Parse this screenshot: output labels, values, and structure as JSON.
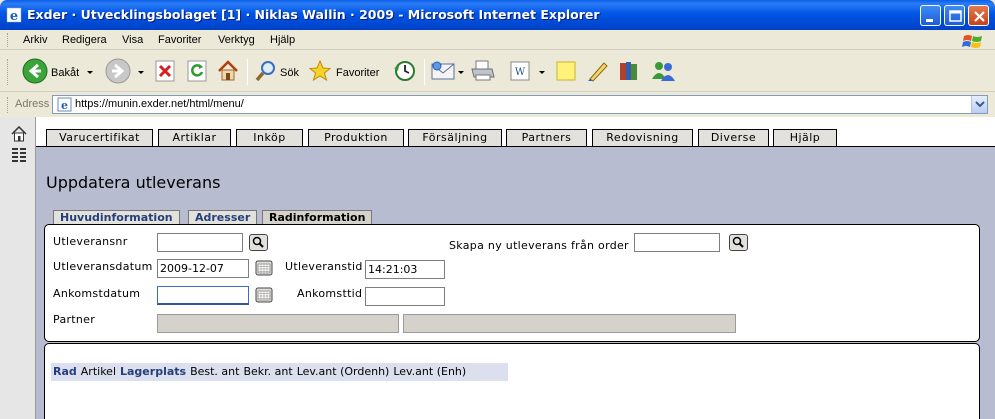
{
  "window": {
    "title": "Exder · Utvecklingsbolaget [1] · Niklas Wallin · 2009 - Microsoft Internet Explorer",
    "controls": [
      "minimize",
      "maximize",
      "close"
    ]
  },
  "menu": {
    "items": [
      "Arkiv",
      "Redigera",
      "Visa",
      "Favoriter",
      "Verktyg",
      "Hjälp"
    ]
  },
  "toolbar": {
    "back_label": "Bakåt",
    "search_label": "Sök",
    "favorites_label": "Favoriter"
  },
  "address": {
    "label": "Adress",
    "url": "https://munin.exder.net/html/menu/"
  },
  "nav": {
    "tabs": [
      "Varucertifikat",
      "Artiklar",
      "Inköp",
      "Produktion",
      "Försäljning",
      "Partners",
      "Redovisning",
      "Diverse",
      "Hjälp"
    ]
  },
  "page": {
    "title": "Uppdatera utleverans",
    "subtabs": [
      "Huvudinformation",
      "Adresser",
      "Radinformation"
    ],
    "active_subtab": "Radinformation"
  },
  "form": {
    "utleveransnr_label": "Utleveransnr",
    "utleveransnr_value": "",
    "skapa_label": "Skapa ny utleverans från order",
    "skapa_value": "",
    "utleveransdatum_label": "Utleveransdatum",
    "utleveransdatum_value": "2009-12-07",
    "utleveranstid_label": "Utleveranstid",
    "utleveranstid_value": "14:21:03",
    "ankomstdatum_label": "Ankomstdatum",
    "ankomstdatum_value": "",
    "ankomsttid_label": "Ankomsttid",
    "ankomsttid_value": "",
    "partner_label": "Partner",
    "partner_code": "",
    "partner_name": ""
  },
  "rows": {
    "columns": [
      {
        "label": "Rad",
        "bold": true
      },
      {
        "label": "Artikel",
        "bold": false
      },
      {
        "label": "Lagerplats",
        "bold": true
      },
      {
        "label": "Best. ant",
        "bold": false
      },
      {
        "label": "Bekr. ant",
        "bold": false
      },
      {
        "label": "Lev.ant (Ordenh)",
        "bold": false
      },
      {
        "label": "Lev.ant (Enh)",
        "bold": false
      }
    ]
  },
  "colors": {
    "titlebar": "#0055E5",
    "main_background": "#B8BCD0",
    "subtab_text": "#243F7A",
    "header_row": "#DCDFEE"
  }
}
